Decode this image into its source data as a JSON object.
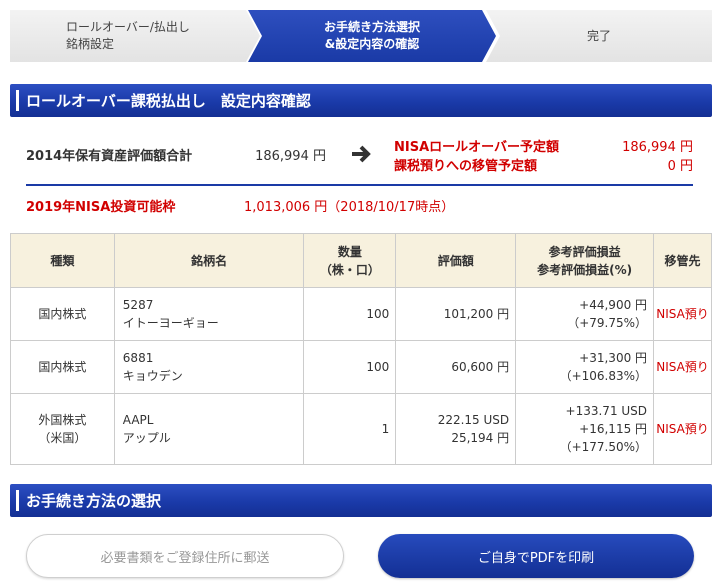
{
  "steps": [
    {
      "line1": "ロールオーバー/払出し",
      "line2": "銘柄設定"
    },
    {
      "line1": "お手続き方法選択",
      "line2": "&設定内容の確認"
    },
    {
      "line1": "完了",
      "line2": ""
    }
  ],
  "section1_title": "ロールオーバー課税払出し　設定内容確認",
  "summary": {
    "total_label": "2014年保有資産評価額合計",
    "total_value": "186,994 円",
    "nisa_label": "NISAロールオーバー予定額",
    "nisa_value": "186,994 円",
    "taxable_label": "課税預りへの移管予定額",
    "taxable_value": "0 円",
    "limit_label": "2019年NISA投資可能枠",
    "limit_value": "1,013,006 円（2018/10/17時点）"
  },
  "table": {
    "headers": {
      "type": "種類",
      "name": "銘柄名",
      "qty_l1": "数量",
      "qty_l2": "（株・口）",
      "value": "評価額",
      "pl_l1": "参考評価損益",
      "pl_l2": "参考評価損益(%)",
      "dest": "移管先"
    },
    "rows": [
      {
        "type_l1": "国内株式",
        "type_l2": "",
        "code": "5287",
        "name": "イトーヨーギョー",
        "qty": "100",
        "value_l1": "101,200 円",
        "value_l2": "",
        "pl_l1": "",
        "pl_l2": "+44,900 円",
        "pl_l3": "（+79.75%）",
        "dest": "NISA預り"
      },
      {
        "type_l1": "国内株式",
        "type_l2": "",
        "code": "6881",
        "name": "キョウデン",
        "qty": "100",
        "value_l1": "60,600 円",
        "value_l2": "",
        "pl_l1": "",
        "pl_l2": "+31,300 円",
        "pl_l3": "（+106.83%）",
        "dest": "NISA預り"
      },
      {
        "type_l1": "外国株式",
        "type_l2": "（米国）",
        "code": "AAPL",
        "name": "アップル",
        "qty": "1",
        "value_l1": "222.15 USD",
        "value_l2": "25,194 円",
        "pl_l1": "+133.71 USD",
        "pl_l2": "+16,115 円",
        "pl_l3": "（+177.50%）",
        "dest": "NISA預り"
      }
    ]
  },
  "section2_title": "お手続き方法の選択",
  "buttons": {
    "mail": "必要書類をご登録住所に郵送",
    "pdf": "ご自身でPDFを印刷"
  },
  "icons": {
    "arrow": "arrow-right-icon"
  },
  "colors": {
    "accent": "#1a3aa6",
    "alert": "#d10000",
    "table_header": "#f7f1de"
  }
}
